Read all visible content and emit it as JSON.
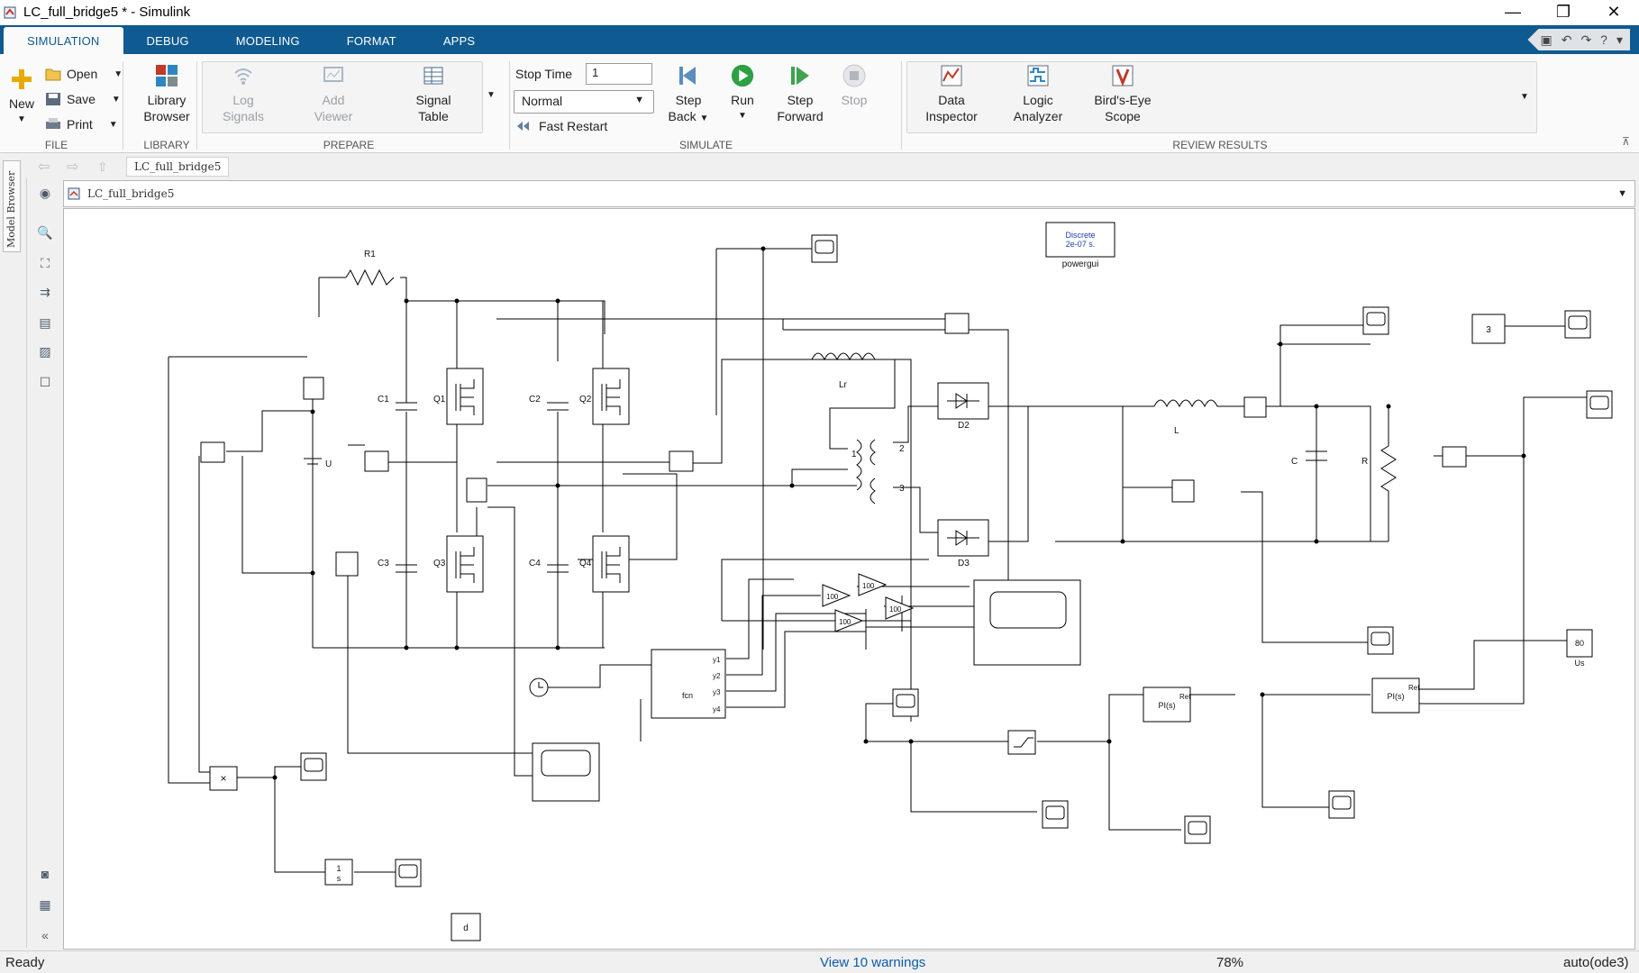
{
  "window": {
    "title": "LC_full_bridge5 * - Simulink",
    "minimize": "—",
    "restore": "❐",
    "close": "✕"
  },
  "tabs": [
    "SIMULATION",
    "DEBUG",
    "MODELING",
    "FORMAT",
    "APPS"
  ],
  "active_tab": "SIMULATION",
  "ribbon": {
    "file": {
      "label": "FILE",
      "new": "New",
      "open": "Open",
      "save": "Save",
      "print": "Print"
    },
    "library": {
      "label": "LIBRARY",
      "browser_line1": "Library",
      "browser_line2": "Browser"
    },
    "prepare": {
      "label": "PREPARE",
      "log_signals_1": "Log",
      "log_signals_2": "Signals",
      "add_viewer_1": "Add",
      "add_viewer_2": "Viewer",
      "signal_table_1": "Signal",
      "signal_table_2": "Table"
    },
    "simulate": {
      "label": "SIMULATE",
      "stop_time_label": "Stop Time",
      "stop_time_value": "1",
      "mode": "Normal",
      "fast_restart": "Fast Restart",
      "step_back_1": "Step",
      "step_back_2": "Back",
      "run": "Run",
      "step_forward_1": "Step",
      "step_forward_2": "Forward",
      "stop": "Stop"
    },
    "review": {
      "label": "REVIEW RESULTS",
      "data_inspector_1": "Data",
      "data_inspector_2": "Inspector",
      "logic_analyzer_1": "Logic",
      "logic_analyzer_2": "Analyzer",
      "birds_eye_1": "Bird's-Eye",
      "birds_eye_2": "Scope"
    }
  },
  "breadcrumb": "LC_full_bridge5",
  "address": "LC_full_bridge5",
  "model_browser": "Model Browser",
  "diagram": {
    "powergui_line1": "Discrete",
    "powergui_line2": "2e-07 s.",
    "powergui_name": "powergui",
    "R1": "R1",
    "C1": "C1",
    "C2": "C2",
    "C3": "C3",
    "C4": "C4",
    "Q1": "Q1",
    "Q2": "Q2",
    "Q3": "Q3",
    "Q4": "Q4",
    "U": "U",
    "Lr": "Lr",
    "D2": "D2",
    "D3": "D3",
    "L": "L",
    "C": "C",
    "R": "R",
    "gain1": "100",
    "gain2": "100",
    "gain3": "100",
    "gain4": "100",
    "gain5": "100",
    "fcn": "fcn",
    "fcn_ports": [
      "y1",
      "y2",
      "y3",
      "y4"
    ],
    "const3": "3",
    "const80": "80",
    "us": "Us",
    "pi1": "PI(s)",
    "pi2": "PI(s)",
    "ref": "Ref",
    "integrator_num": "1",
    "integrator_den": "s",
    "product": "×",
    "d_display": "d",
    "tf_1": "1",
    "tf_2": "2",
    "tf_3": "3"
  },
  "status": {
    "left": "Ready",
    "warnings": "View 10 warnings",
    "zoom": "78%",
    "solver": "auto(ode3)"
  },
  "colors": {
    "tabbar": "#0f5a90",
    "run_green": "#2ea043",
    "link_blue": "#0b5cad"
  }
}
